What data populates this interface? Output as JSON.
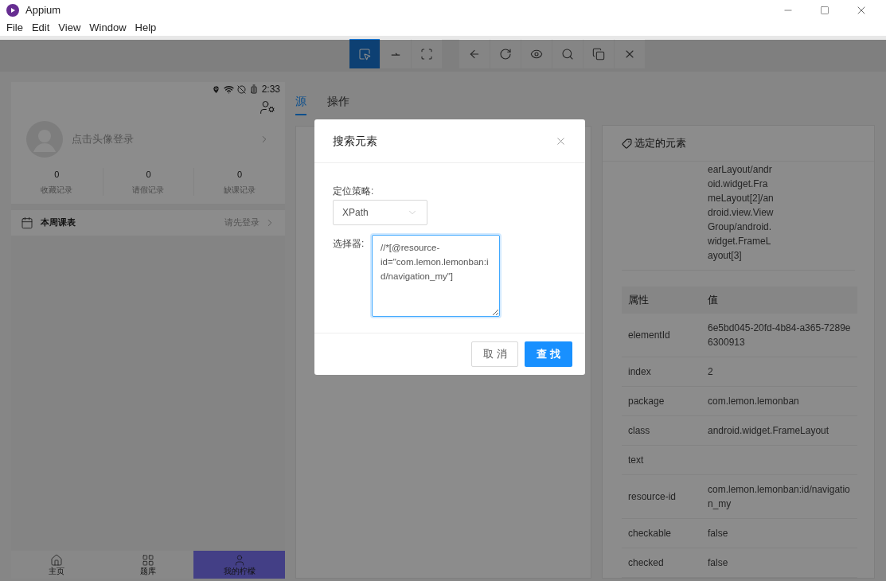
{
  "window": {
    "title": "Appium"
  },
  "menu": [
    "File",
    "Edit",
    "View",
    "Window",
    "Help"
  ],
  "toolbar": [
    [
      {
        "selected": true
      },
      {
        "selected": false
      },
      {
        "selected": false
      }
    ],
    [
      {
        "selected": false
      },
      {
        "selected": false
      },
      {
        "selected": false
      },
      {
        "selected": false
      },
      {
        "selected": false
      },
      {
        "selected": false
      }
    ]
  ],
  "device": {
    "status_time": "2:33",
    "login_prompt": "点击头像登录",
    "stats": [
      {
        "value": "0",
        "label": "收藏记录"
      },
      {
        "value": "0",
        "label": "请假记录"
      },
      {
        "value": "0",
        "label": "缺课记录"
      }
    ],
    "schedule": {
      "title": "本周课表",
      "action": "请先登录"
    },
    "nav": [
      {
        "label": "主页",
        "selected": false
      },
      {
        "label": "题库",
        "selected": false
      },
      {
        "label": "我的柠檬",
        "selected": true
      }
    ]
  },
  "tabs": [
    {
      "label": "源",
      "selected": true
    },
    {
      "label": "操作",
      "selected": false
    }
  ],
  "selected_element": {
    "title": "选定的元素",
    "xpath": "earLayout/android.widget.FrameLayout[2]/android.view.ViewGroup/android.widget.FrameLayout[3]",
    "columns": [
      "属性",
      "值"
    ],
    "rows": [
      [
        "elementId",
        "6e5bd045-20fd-4b84-a365-7289e6300913"
      ],
      [
        "index",
        "2"
      ],
      [
        "package",
        "com.lemon.lemonban"
      ],
      [
        "class",
        "android.widget.FrameLayout"
      ],
      [
        "text",
        ""
      ],
      [
        "resource-id",
        "com.lemon.lemonban:id/navigation_my"
      ],
      [
        "checkable",
        "false"
      ],
      [
        "checked",
        "false"
      ]
    ]
  },
  "dialog": {
    "title": "搜索元素",
    "strategy_label": "定位策略:",
    "strategy": "XPath",
    "selector_label": "选择器:",
    "selector": "//*[@resource-id=\"com.lemon.lemonban:id/navigation_my\"]",
    "buttons": [
      {
        "label": "取消",
        "kind": "default"
      },
      {
        "label": "查找",
        "kind": "primary"
      }
    ]
  }
}
